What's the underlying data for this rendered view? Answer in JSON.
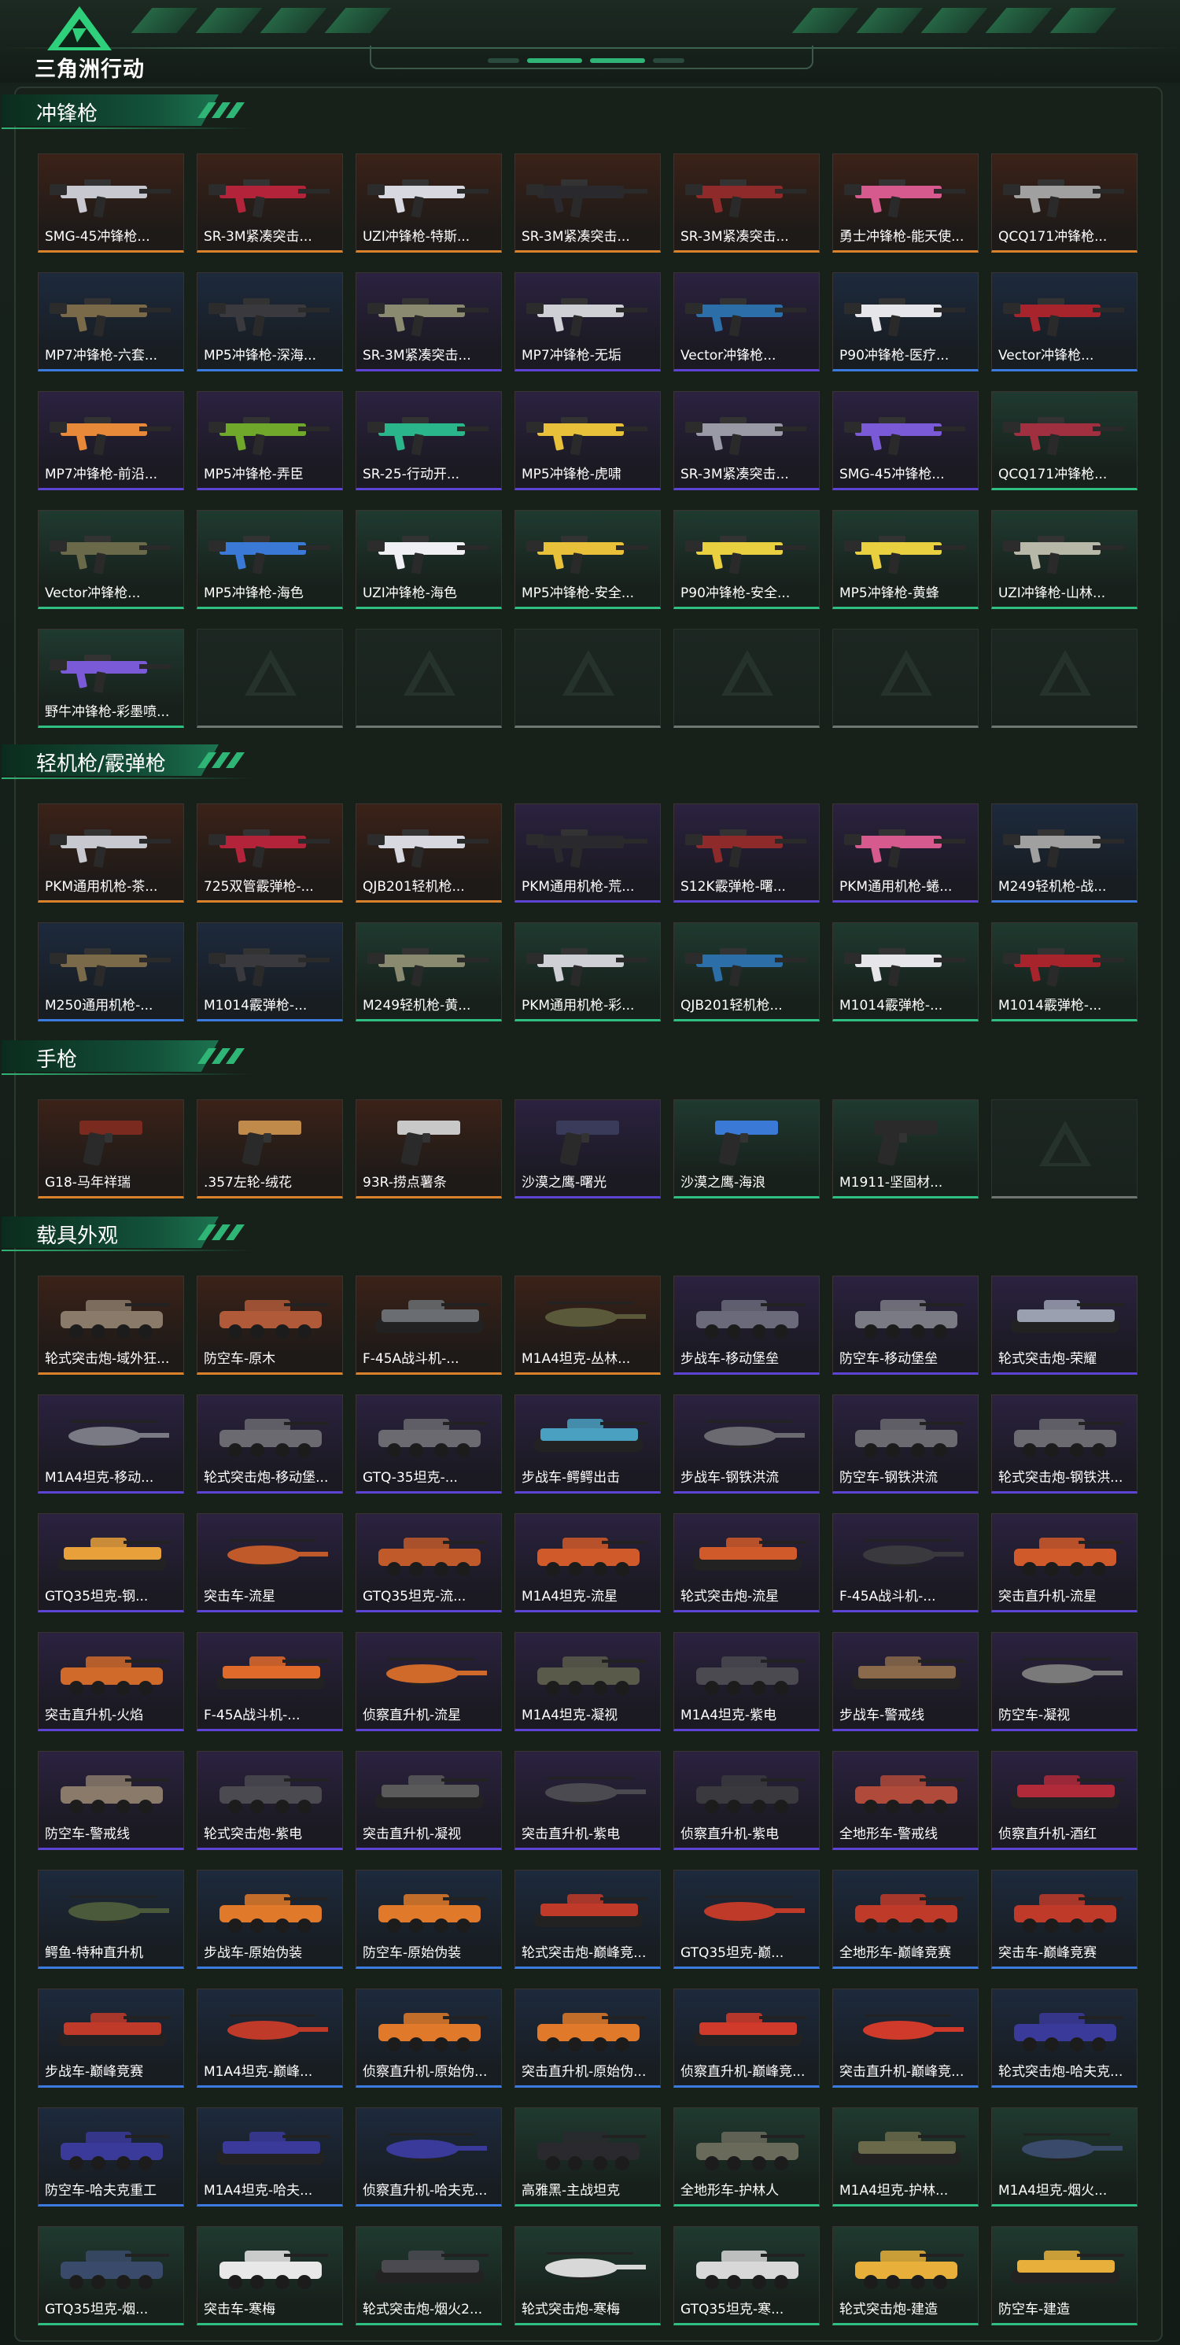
{
  "header": {
    "logo_text": "三角洲行动"
  },
  "colors": {
    "accent": "#2fb576",
    "rarity_orange": "#d9822b",
    "rarity_purple": "#5d44d4",
    "rarity_blue": "#3b7be0",
    "rarity_green": "#2fbf82"
  },
  "sections": [
    {
      "title": "冲锋枪",
      "kind": "gun",
      "items": [
        {
          "name": "SMG-45冲锋枪...",
          "rarity": "orange"
        },
        {
          "name": "SR-3M紧凑突击...",
          "rarity": "orange"
        },
        {
          "name": "UZI冲锋枪-特斯...",
          "rarity": "orange"
        },
        {
          "name": "SR-3M紧凑突击...",
          "rarity": "orange"
        },
        {
          "name": "SR-3M紧凑突击...",
          "rarity": "orange"
        },
        {
          "name": "勇士冲锋枪-能天使...",
          "rarity": "orange"
        },
        {
          "name": "QCQ171冲锋枪...",
          "rarity": "orange"
        },
        {
          "name": "MP7冲锋枪-六套...",
          "rarity": "blue"
        },
        {
          "name": "MP5冲锋枪-深海...",
          "rarity": "blue"
        },
        {
          "name": "SR-3M紧凑突击...",
          "rarity": "purple"
        },
        {
          "name": "MP7冲锋枪-无垢",
          "rarity": "purple"
        },
        {
          "name": "Vector冲锋枪...",
          "rarity": "purple"
        },
        {
          "name": "P90冲锋枪-医疗...",
          "rarity": "blue"
        },
        {
          "name": "Vector冲锋枪...",
          "rarity": "blue"
        },
        {
          "name": "MP7冲锋枪-前沿...",
          "rarity": "purple"
        },
        {
          "name": "MP5冲锋枪-弄臣",
          "rarity": "purple"
        },
        {
          "name": "SR-25-行动开...",
          "rarity": "purple"
        },
        {
          "name": "MP5冲锋枪-虎啸",
          "rarity": "purple"
        },
        {
          "name": "SR-3M紧凑突击...",
          "rarity": "purple"
        },
        {
          "name": "SMG-45冲锋枪...",
          "rarity": "purple"
        },
        {
          "name": "QCQ171冲锋枪...",
          "rarity": "green"
        },
        {
          "name": "Vector冲锋枪...",
          "rarity": "green"
        },
        {
          "name": "MP5冲锋枪-海色",
          "rarity": "green"
        },
        {
          "name": "UZI冲锋枪-海色",
          "rarity": "green"
        },
        {
          "name": "MP5冲锋枪-安全...",
          "rarity": "green"
        },
        {
          "name": "P90冲锋枪-安全...",
          "rarity": "green"
        },
        {
          "name": "MP5冲锋枪-黄蜂",
          "rarity": "green"
        },
        {
          "name": "UZI冲锋枪-山林...",
          "rarity": "green"
        },
        {
          "name": "野牛冲锋枪-彩墨喷...",
          "rarity": "green"
        },
        {
          "name": "",
          "rarity": "empty"
        },
        {
          "name": "",
          "rarity": "empty"
        },
        {
          "name": "",
          "rarity": "empty"
        },
        {
          "name": "",
          "rarity": "empty"
        },
        {
          "name": "",
          "rarity": "empty"
        },
        {
          "name": "",
          "rarity": "empty"
        }
      ]
    },
    {
      "title": "轻机枪/霰弹枪",
      "kind": "gun",
      "items": [
        {
          "name": "PKM通用机枪-茶...",
          "rarity": "orange"
        },
        {
          "name": "725双管霰弹枪-...",
          "rarity": "orange"
        },
        {
          "name": "QJB201轻机枪...",
          "rarity": "orange"
        },
        {
          "name": "PKM通用机枪-荒...",
          "rarity": "purple"
        },
        {
          "name": "S12K霰弹枪-曙...",
          "rarity": "purple"
        },
        {
          "name": "PKM通用机枪-蜷...",
          "rarity": "purple"
        },
        {
          "name": "M249轻机枪-战...",
          "rarity": "blue"
        },
        {
          "name": "M250通用机枪-...",
          "rarity": "blue"
        },
        {
          "name": "M1014霰弹枪-...",
          "rarity": "blue"
        },
        {
          "name": "M249轻机枪-黄...",
          "rarity": "green"
        },
        {
          "name": "PKM通用机枪-彩...",
          "rarity": "green"
        },
        {
          "name": "QJB201轻机枪...",
          "rarity": "green"
        },
        {
          "name": "M1014霰弹枪-...",
          "rarity": "green"
        },
        {
          "name": "M1014霰弹枪-...",
          "rarity": "green"
        }
      ]
    },
    {
      "title": "手枪",
      "kind": "pistol",
      "items": [
        {
          "name": "G18-马年祥瑞",
          "rarity": "orange"
        },
        {
          "name": ".357左轮-绒花",
          "rarity": "orange"
        },
        {
          "name": "93R-捞点薯条",
          "rarity": "orange"
        },
        {
          "name": "沙漠之鹰-曙光",
          "rarity": "purple"
        },
        {
          "name": "沙漠之鹰-海浪",
          "rarity": "green"
        },
        {
          "name": "M1911-坚固材...",
          "rarity": "green"
        },
        {
          "name": "",
          "rarity": "empty"
        }
      ]
    },
    {
      "title": "载具外观",
      "kind": "vehicle",
      "items": [
        {
          "name": "轮式突击炮-域外狂...",
          "rarity": "orange"
        },
        {
          "name": "防空车-原木",
          "rarity": "orange"
        },
        {
          "name": "F-45A战斗机-...",
          "rarity": "orange"
        },
        {
          "name": "M1A4坦克-丛林...",
          "rarity": "orange"
        },
        {
          "name": "步战车-移动堡垒",
          "rarity": "purple"
        },
        {
          "name": "防空车-移动堡垒",
          "rarity": "purple"
        },
        {
          "name": "轮式突击炮-荣耀",
          "rarity": "purple"
        },
        {
          "name": "M1A4坦克-移动...",
          "rarity": "purple"
        },
        {
          "name": "轮式突击炮-移动堡...",
          "rarity": "purple"
        },
        {
          "name": "GTQ-35坦克-...",
          "rarity": "purple"
        },
        {
          "name": "步战车-鳄鳄出击",
          "rarity": "purple"
        },
        {
          "name": "步战车-钢铁洪流",
          "rarity": "purple"
        },
        {
          "name": "防空车-钢铁洪流",
          "rarity": "purple"
        },
        {
          "name": "轮式突击炮-钢铁洪...",
          "rarity": "purple"
        },
        {
          "name": "GTQ35坦克-钢...",
          "rarity": "purple"
        },
        {
          "name": "突击车-流星",
          "rarity": "purple"
        },
        {
          "name": "GTQ35坦克-流...",
          "rarity": "purple"
        },
        {
          "name": "M1A4坦克-流星",
          "rarity": "purple"
        },
        {
          "name": "轮式突击炮-流星",
          "rarity": "purple"
        },
        {
          "name": "F-45A战斗机-...",
          "rarity": "purple"
        },
        {
          "name": "突击直升机-流星",
          "rarity": "purple"
        },
        {
          "name": "突击直升机-火焰",
          "rarity": "purple"
        },
        {
          "name": "F-45A战斗机-...",
          "rarity": "purple"
        },
        {
          "name": "侦察直升机-流星",
          "rarity": "purple"
        },
        {
          "name": "M1A4坦克-凝视",
          "rarity": "purple"
        },
        {
          "name": "M1A4坦克-紫电",
          "rarity": "purple"
        },
        {
          "name": "步战车-警戒线",
          "rarity": "purple"
        },
        {
          "name": "防空车-凝视",
          "rarity": "purple"
        },
        {
          "name": "防空车-警戒线",
          "rarity": "purple"
        },
        {
          "name": "轮式突击炮-紫电",
          "rarity": "purple"
        },
        {
          "name": "突击直升机-凝视",
          "rarity": "purple"
        },
        {
          "name": "突击直升机-紫电",
          "rarity": "purple"
        },
        {
          "name": "侦察直升机-紫电",
          "rarity": "purple"
        },
        {
          "name": "全地形车-警戒线",
          "rarity": "purple"
        },
        {
          "name": "侦察直升机-酒红",
          "rarity": "purple"
        },
        {
          "name": "鳄鱼-特种直升机",
          "rarity": "blue"
        },
        {
          "name": "步战车-原始伪装",
          "rarity": "blue"
        },
        {
          "name": "防空车-原始伪装",
          "rarity": "blue"
        },
        {
          "name": "轮式突击炮-巅峰竞...",
          "rarity": "blue"
        },
        {
          "name": "GTQ35坦克-巅...",
          "rarity": "blue"
        },
        {
          "name": "全地形车-巅峰竞赛",
          "rarity": "blue"
        },
        {
          "name": "突击车-巅峰竞赛",
          "rarity": "blue"
        },
        {
          "name": "步战车-巅峰竞赛",
          "rarity": "blue"
        },
        {
          "name": "M1A4坦克-巅峰...",
          "rarity": "blue"
        },
        {
          "name": "侦察直升机-原始伪...",
          "rarity": "blue"
        },
        {
          "name": "突击直升机-原始伪...",
          "rarity": "blue"
        },
        {
          "name": "侦察直升机-巅峰竞...",
          "rarity": "blue"
        },
        {
          "name": "突击直升机-巅峰竞...",
          "rarity": "blue"
        },
        {
          "name": "轮式突击炮-哈夫克...",
          "rarity": "blue"
        },
        {
          "name": "防空车-哈夫克重工",
          "rarity": "blue"
        },
        {
          "name": "M1A4坦克-哈夫...",
          "rarity": "blue"
        },
        {
          "name": "侦察直升机-哈夫克...",
          "rarity": "blue"
        },
        {
          "name": "高雅黑-主战坦克",
          "rarity": "green"
        },
        {
          "name": "全地形车-护林人",
          "rarity": "green"
        },
        {
          "name": "M1A4坦克-护林...",
          "rarity": "green"
        },
        {
          "name": "M1A4坦克-烟火...",
          "rarity": "green"
        },
        {
          "name": "GTQ35坦克-烟...",
          "rarity": "green"
        },
        {
          "name": "突击车-寒梅",
          "rarity": "green"
        },
        {
          "name": "轮式突击炮-烟火2...",
          "rarity": "green"
        },
        {
          "name": "轮式突击炮-寒梅",
          "rarity": "green"
        },
        {
          "name": "GTQ35坦克-寒...",
          "rarity": "green"
        },
        {
          "name": "轮式突击炮-建造",
          "rarity": "green"
        },
        {
          "name": "防空车-建造",
          "rarity": "green"
        }
      ]
    }
  ]
}
